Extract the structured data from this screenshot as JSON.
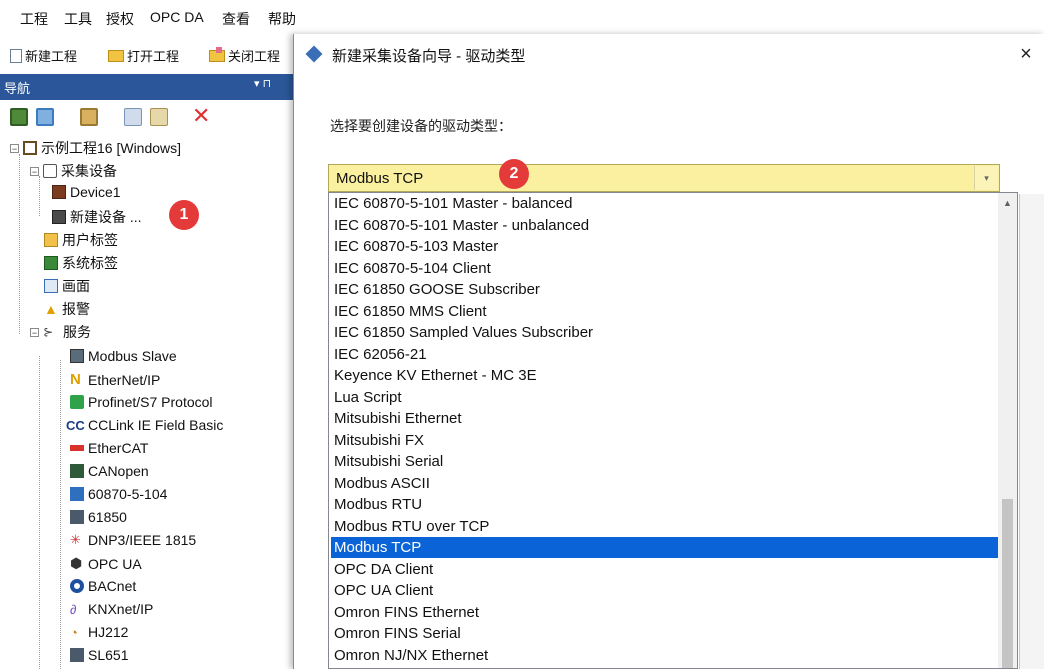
{
  "menubar": {
    "items": [
      "工程",
      "工具",
      "授权",
      "OPC DA",
      "查看",
      "帮助"
    ]
  },
  "toolbar": {
    "new_project": "新建工程",
    "open_project": "打开工程",
    "close_project": "关闭工程"
  },
  "nav": {
    "title": "导航",
    "pin": "▾ ⊓",
    "tree": {
      "root": "示例工程16 [Windows]",
      "devices": "采集设备",
      "device1": "Device1",
      "new_device": "新建设备 ...",
      "user_tags": "用户标签",
      "system_tags": "系统标签",
      "screens": "画面",
      "alarms": "报警",
      "services": "服务",
      "service_items": [
        "Modbus Slave",
        "EtherNet/IP",
        "Profinet/S7 Protocol",
        "CCLink IE Field Basic",
        "EtherCAT",
        "CANopen",
        "60870-5-104",
        "61850",
        "DNP3/IEEE 1815",
        "OPC UA",
        "BACnet",
        "KNXnet/IP",
        "HJ212",
        "SL651"
      ]
    }
  },
  "badges": [
    "1",
    "2"
  ],
  "dialog": {
    "title": "新建采集设备向导 - 驱动类型",
    "close": "×",
    "prompt": "选择要创建设备的驱动类型：",
    "combo": {
      "value": "Modbus TCP",
      "arrow": "▾"
    },
    "scroll_up": "▲",
    "options": [
      "IEC 60870-5-101 Master - balanced",
      "IEC 60870-5-101 Master - unbalanced",
      "IEC 60870-5-103 Master",
      "IEC 60870-5-104 Client",
      "IEC 61850 GOOSE Subscriber",
      "IEC 61850 MMS Client",
      "IEC 61850 Sampled Values Subscriber",
      "IEC 62056-21",
      "Keyence KV Ethernet - MC 3E",
      "Lua Script",
      "Mitsubishi Ethernet",
      "Mitsubishi FX",
      "Mitsubishi Serial",
      "Modbus ASCII",
      "Modbus RTU",
      "Modbus RTU over TCP",
      "Modbus TCP",
      "OPC DA Client",
      "OPC UA Client",
      "Omron FINS Ethernet",
      "Omron FINS Serial",
      "Omron NJ/NX Ethernet"
    ],
    "selected_option": "Modbus TCP"
  },
  "colors": {
    "nav_header": "#2b579a",
    "selection": "#0a64d7",
    "combo_bg": "#fbf0a0",
    "badge": "#e53a3a"
  }
}
